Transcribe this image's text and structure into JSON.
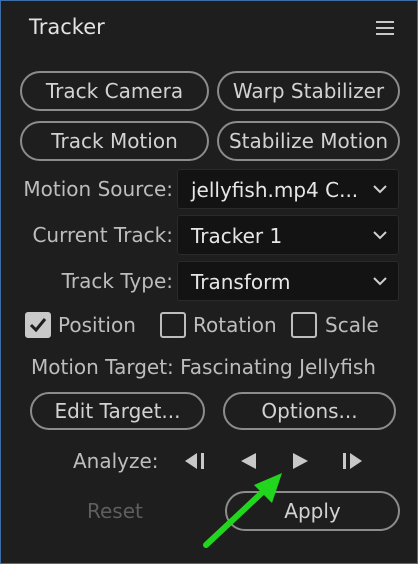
{
  "panel": {
    "title": "Tracker",
    "menu_icon": "hamburger-menu-icon"
  },
  "buttons": {
    "track_camera": "Track Camera",
    "warp_stabilizer": "Warp Stabilizer",
    "track_motion": "Track Motion",
    "stabilize_motion": "Stabilize Motion",
    "edit_target": "Edit Target...",
    "options": "Options...",
    "reset": "Reset",
    "apply": "Apply"
  },
  "fields": {
    "motion_source": {
      "label": "Motion Source:",
      "value": "jellyfish.mp4 C..."
    },
    "current_track": {
      "label": "Current Track:",
      "value": "Tracker 1"
    },
    "track_type": {
      "label": "Track Type:",
      "value": "Transform"
    }
  },
  "checkboxes": [
    {
      "label": "Position",
      "checked": true
    },
    {
      "label": "Rotation",
      "checked": false
    },
    {
      "label": "Scale",
      "checked": false
    }
  ],
  "motion_target": "Motion Target: Fascinating Jellyfish",
  "analyze": {
    "label": "Analyze:",
    "controls": [
      "analyze-1-frame-backward-icon",
      "analyze-backward-icon",
      "analyze-forward-icon",
      "analyze-1-frame-forward-icon"
    ]
  },
  "colors": {
    "panel_border": "#3e6ea8",
    "annotation_arrow": "#22d61e",
    "disabled_text": "#5e5e5e"
  }
}
